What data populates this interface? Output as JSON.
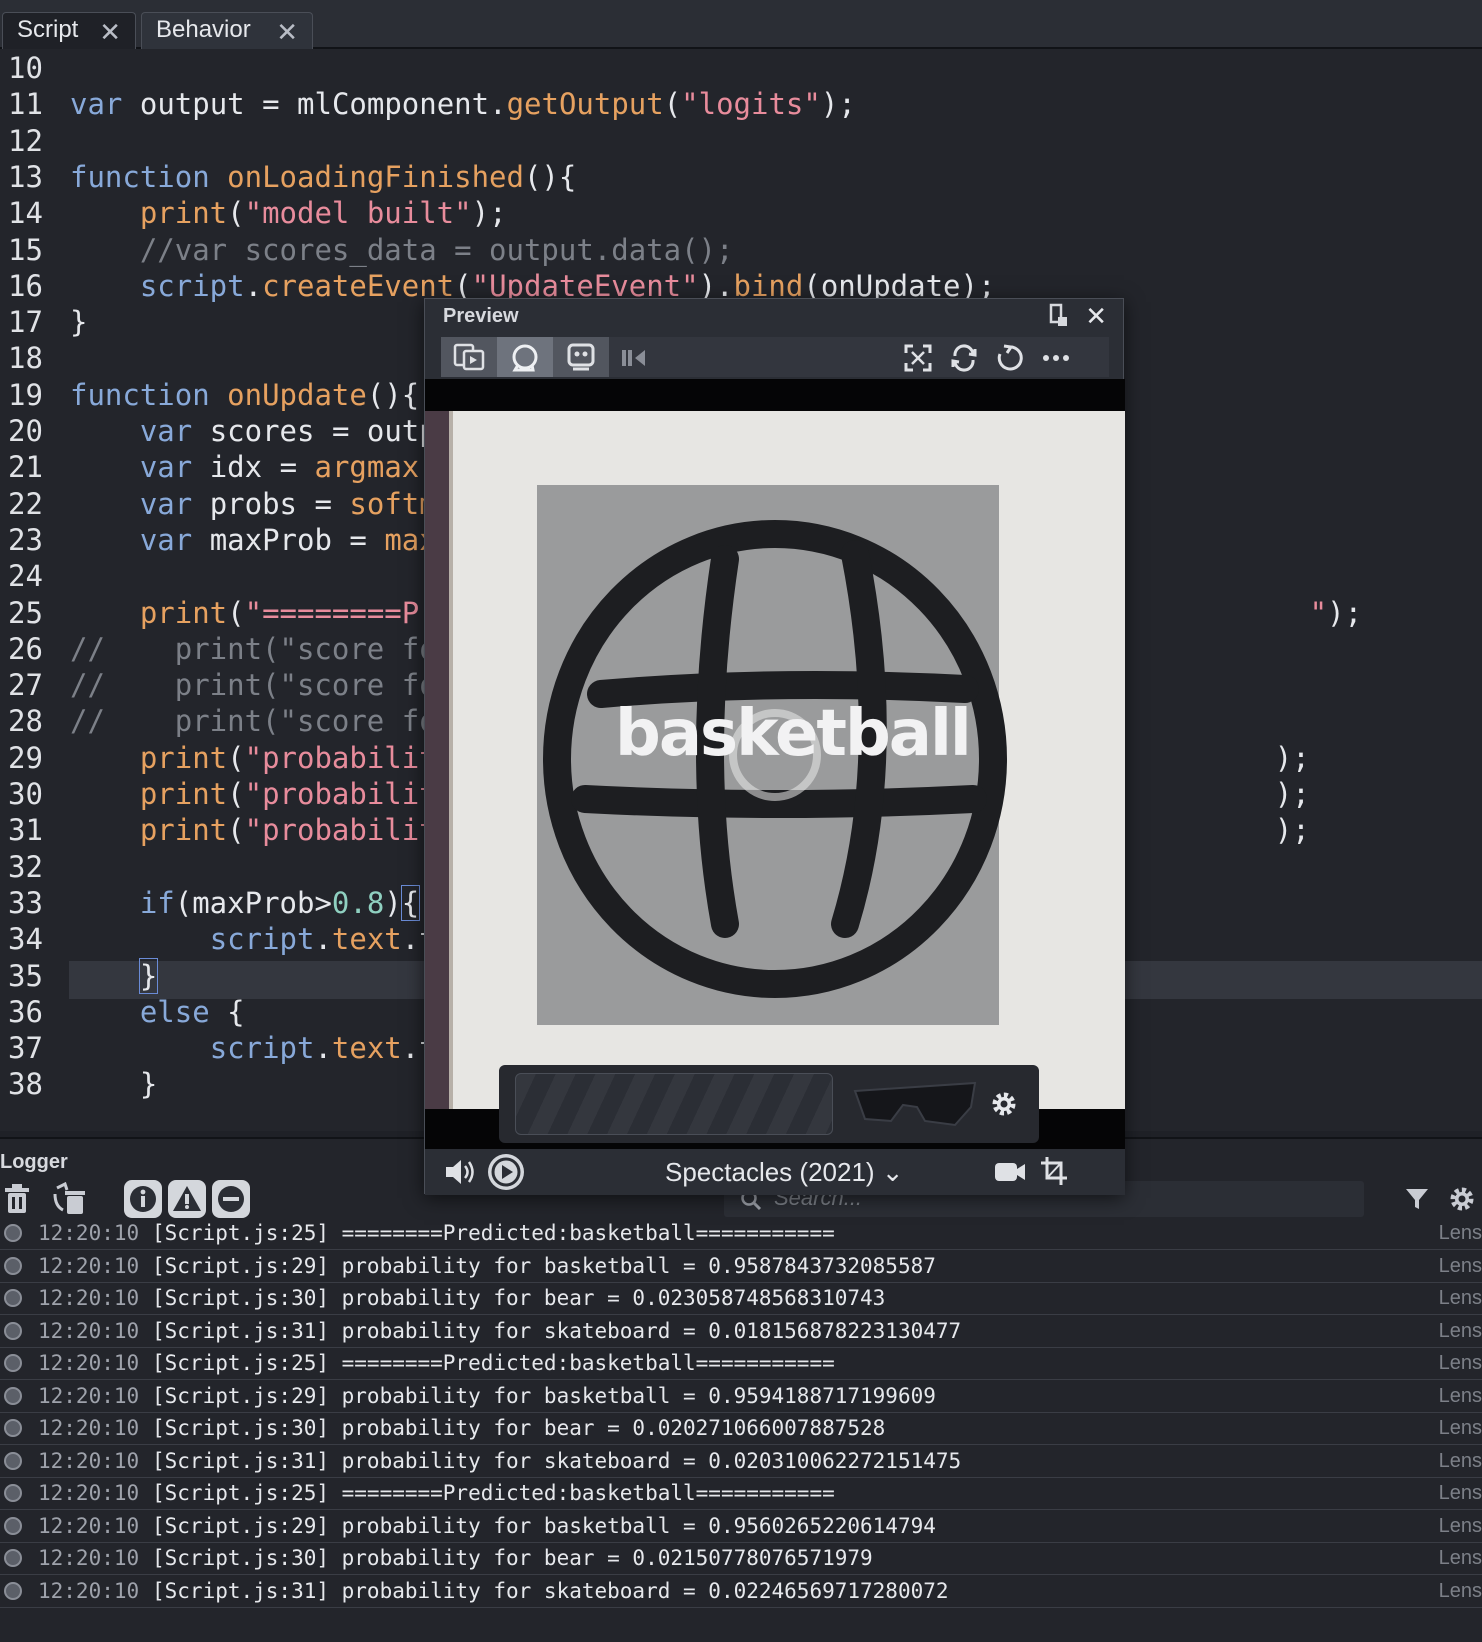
{
  "tabs": [
    {
      "label": "Script",
      "close": "✕"
    },
    {
      "label": "Behavior",
      "close": "✕"
    }
  ],
  "editor": {
    "lines": [
      {
        "n": "10",
        "html": ""
      },
      {
        "n": "11",
        "html": "<span class='kw'>var</span> <span class='id'>output</span> <span class='id'>=</span> <span class='id'>mlComponent</span><span class='id'>.</span><span class='fn'>getOutput</span><span class='id'>(</span><span class='str'>\"logits\"</span><span class='id'>);</span>"
      },
      {
        "n": "12",
        "html": ""
      },
      {
        "n": "13",
        "html": "<span class='kw'>function</span> <span class='fn'>onLoadingFinished</span><span class='id'>(){</span>"
      },
      {
        "n": "14",
        "html": "    <span class='fn'>print</span><span class='id'>(</span><span class='str'>\"model built\"</span><span class='id'>);</span>"
      },
      {
        "n": "15",
        "html": "    <span class='cm'>//var scores_data = output.data();</span>"
      },
      {
        "n": "16",
        "html": "    <span class='kw'>script</span><span class='id'>.</span><span class='fn'>createEvent</span><span class='id'>(</span><span class='str'>\"UpdateEvent\"</span><span class='id'>).</span><span class='fn'>bind</span><span class='id'>(onUpdate);</span>"
      },
      {
        "n": "17",
        "html": "<span class='id'>}</span>"
      },
      {
        "n": "18",
        "html": ""
      },
      {
        "n": "19",
        "html": "<span class='kw'>function</span> <span class='fn'>onUpdate</span><span class='id'>(){</span>"
      },
      {
        "n": "20",
        "html": "    <span class='kw'>var</span> <span class='id'>scores</span> <span class='id'>=</span> <span class='id'>outp</span>"
      },
      {
        "n": "21",
        "html": "    <span class='kw'>var</span> <span class='id'>idx</span> <span class='id'>=</span> <span class='fn'>argmax</span><span class='id'>(</span>"
      },
      {
        "n": "22",
        "html": "    <span class='kw'>var</span> <span class='id'>probs</span> <span class='id'>=</span> <span class='fn'>softm</span>"
      },
      {
        "n": "23",
        "html": "    <span class='kw'>var</span> <span class='id'>maxProb</span> <span class='id'>=</span> <span class='fn'>max</span>"
      },
      {
        "n": "24",
        "html": ""
      },
      {
        "n": "25",
        "html": "    <span class='fn'>print</span><span class='id'>(</span><span class='str'>\"========Pr</span>                                                  <span class='str'>\"</span><span class='id'>);</span>"
      },
      {
        "n": "26",
        "html": "<span class='cm'>//    print(\"score fo</span>"
      },
      {
        "n": "27",
        "html": "<span class='cm'>//    print(\"score fo</span>"
      },
      {
        "n": "28",
        "html": "<span class='cm'>//    print(\"score fo</span>"
      },
      {
        "n": "29",
        "html": "    <span class='fn'>print</span><span class='id'>(</span><span class='str'>\"probabilit</span>                                                <span class='id'>);</span>"
      },
      {
        "n": "30",
        "html": "    <span class='fn'>print</span><span class='id'>(</span><span class='str'>\"probabilit</span>                                                <span class='id'>);</span>"
      },
      {
        "n": "31",
        "html": "    <span class='fn'>print</span><span class='id'>(</span><span class='str'>\"probabilit</span>                                                <span class='id'>);</span>"
      },
      {
        "n": "32",
        "html": ""
      },
      {
        "n": "33",
        "html": "    <span class='kw'>if</span><span class='id'>(maxProb&gt;</span><span class='num'>0.8</span><span class='id'>)</span><span class='id bracket-box'>{</span>"
      },
      {
        "n": "34",
        "html": "        <span class='kw'>script</span><span class='id'>.</span><span class='prop'>text</span><span class='id'>.</span><span class='id'>t</span>"
      },
      {
        "n": "35",
        "html": "    <span class='id bracket-box'>}</span>"
      },
      {
        "n": "36",
        "html": "    <span class='kw'>else</span> <span class='id'>{</span>"
      },
      {
        "n": "37",
        "html": "        <span class='kw'>script</span><span class='id'>.</span><span class='prop'>text</span><span class='id'>.</span><span class='id'>t</span>"
      },
      {
        "n": "38",
        "html": "    <span class='id'>}</span>"
      }
    ]
  },
  "preview": {
    "title": "Preview",
    "overlay_label": "basketball",
    "device": "Spectacles (2021)",
    "device_caret": "⌄"
  },
  "logger": {
    "title": "Logger",
    "search_placeholder": "Search...",
    "rows": [
      {
        "time": "12:20:10",
        "msg": "[Script.js:25] ========Predicted:basketball===========",
        "src": "Lens"
      },
      {
        "time": "12:20:10",
        "msg": "[Script.js:29] probability for basketball = 0.9587843732085587",
        "src": "Lens"
      },
      {
        "time": "12:20:10",
        "msg": "[Script.js:30] probability for bear = 0.023058748568310743",
        "src": "Lens"
      },
      {
        "time": "12:20:10",
        "msg": "[Script.js:31] probability for skateboard = 0.018156878223130477",
        "src": "Lens"
      },
      {
        "time": "12:20:10",
        "msg": "[Script.js:25] ========Predicted:basketball===========",
        "src": "Lens"
      },
      {
        "time": "12:20:10",
        "msg": "[Script.js:29] probability for basketball = 0.9594188717199609",
        "src": "Lens"
      },
      {
        "time": "12:20:10",
        "msg": "[Script.js:30] probability for bear = 0.020271066007887528",
        "src": "Lens"
      },
      {
        "time": "12:20:10",
        "msg": "[Script.js:31] probability for skateboard = 0.020310062272151475",
        "src": "Lens"
      },
      {
        "time": "12:20:10",
        "msg": "[Script.js:25] ========Predicted:basketball===========",
        "src": "Lens"
      },
      {
        "time": "12:20:10",
        "msg": "[Script.js:29] probability for basketball = 0.9560265220614794",
        "src": "Lens"
      },
      {
        "time": "12:20:10",
        "msg": "[Script.js:30] probability for bear = 0.02150778076571979",
        "src": "Lens"
      },
      {
        "time": "12:20:10",
        "msg": "[Script.js:31] probability for skateboard = 0.02246569717280072",
        "src": "Lens"
      }
    ]
  },
  "icons": {
    "tab_close": "close-icon",
    "logger_clear": "trash-icon",
    "logger_clear_all": "trash-all-icon",
    "filter_info": "info-icon",
    "filter_warning": "warning-icon",
    "filter_error": "error-icon",
    "filter": "filter-icon",
    "settings": "gear-icon",
    "search": "search-icon"
  },
  "colors": {
    "keyword": "#88a9d9",
    "function": "#e6a160",
    "string": "#e88c9c",
    "comment": "#7c8088",
    "number": "#8fd0c0",
    "background": "#23252b"
  }
}
